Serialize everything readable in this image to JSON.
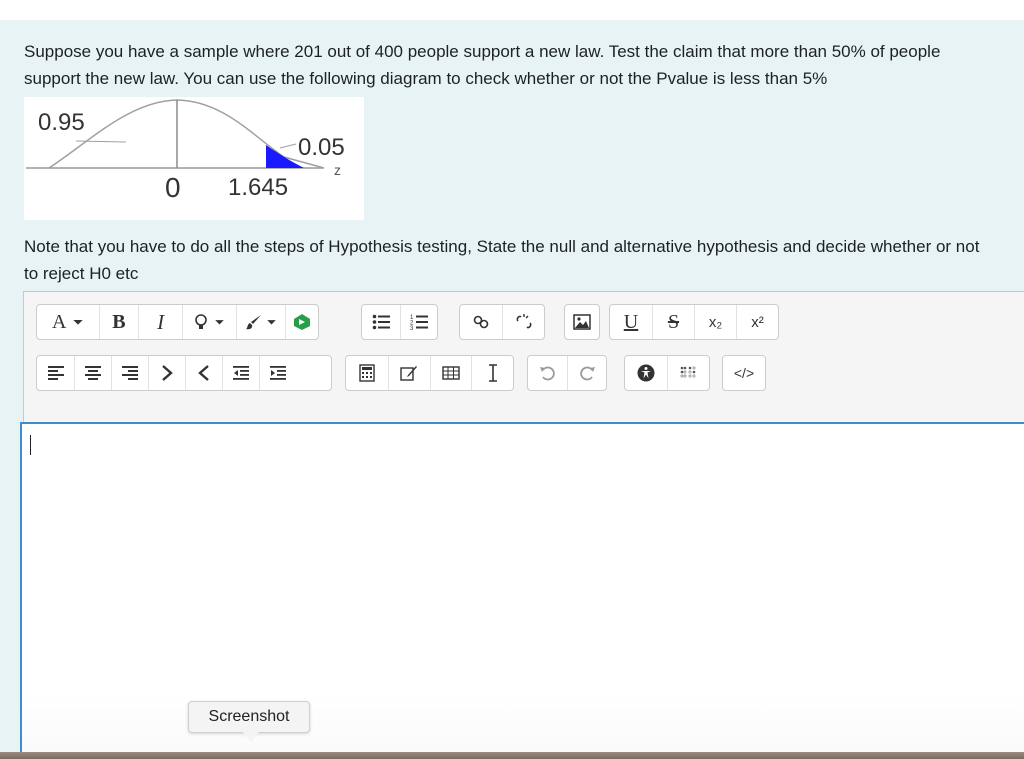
{
  "question": {
    "text": "Suppose you have a sample where 201 out of 400 people support a new law. Test the claim that more than 50% of people support the new law. You can use the following diagram to check whether or not the Pvalue is less than 5%",
    "note": "Note that you have to do all the steps of Hypothesis testing, State the null and alternative hypothesis and decide whether or not to reject H0 etc"
  },
  "diagram": {
    "label_left_area": "0.95",
    "label_right_tail": "0.05",
    "label_axis": "z",
    "label_center": "0",
    "label_critical": "1.645",
    "shade_color": "#1a1aff"
  },
  "editor": {
    "toolbar_row1": [
      {
        "name": "font-style-dropdown-button",
        "label": "A",
        "icon": "chevron-down"
      },
      {
        "name": "bold-button",
        "label": "B"
      },
      {
        "name": "italic-button",
        "label": "I"
      },
      {
        "name": "lightbulb-dropdown-button",
        "icon": "lightbulb-icon"
      },
      {
        "name": "paint-brush-dropdown-button",
        "icon": "paint-brush-icon"
      },
      {
        "name": "media-button",
        "icon": "h5p-icon"
      },
      {
        "name": "unordered-list-button",
        "icon": "list-ul-icon"
      },
      {
        "name": "ordered-list-button",
        "icon": "list-ol-icon"
      },
      {
        "name": "link-button",
        "icon": "link-icon"
      },
      {
        "name": "unlink-button",
        "icon": "unlink-icon"
      },
      {
        "name": "image-button",
        "icon": "image-icon"
      },
      {
        "name": "underline-button",
        "label": "U"
      },
      {
        "name": "strikethrough-button",
        "label": "S"
      },
      {
        "name": "subscript-button",
        "label": "x₂"
      },
      {
        "name": "superscript-button",
        "label": "x²"
      }
    ],
    "toolbar_row2": [
      "align-left-icon",
      "align-center-icon",
      "align-right-icon",
      "ltr-icon",
      "rtl-icon",
      "outdent-icon",
      "indent-icon",
      "equation-icon",
      "edit-icon",
      "table-icon",
      "clear-format-icon",
      "undo-icon",
      "redo-icon",
      "accessibility-icon",
      "braille-icon",
      "html-icon"
    ],
    "html_button_label": "</>",
    "accent_color": "#3b8ed0"
  },
  "tooltip": {
    "text": "Screenshot"
  }
}
